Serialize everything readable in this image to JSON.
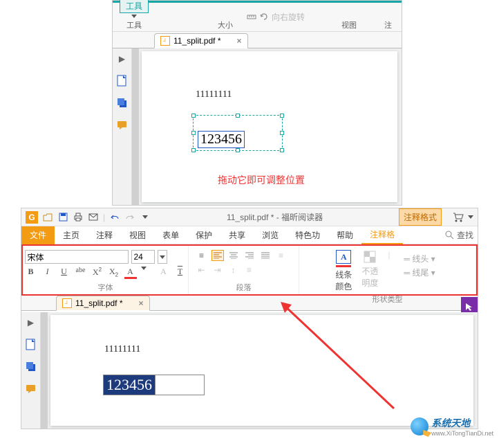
{
  "top": {
    "ribbon": {
      "tool_group": "工具",
      "tool_label": "工具",
      "size_label": "大小",
      "rotate_text": "向右旋转",
      "view_label": "视图",
      "annot_label": "注"
    },
    "tab": {
      "filename": "11_split.pdf *",
      "close": "×"
    },
    "doc": {
      "text1": "11111111",
      "boxtext": "123456"
    },
    "note": "拖动它即可调整位置"
  },
  "bottom": {
    "title_doc": "11_split.pdf *",
    "title_app": "- 福昕阅读器",
    "menu": {
      "file": "文件",
      "home": "主页",
      "comment": "注释",
      "view": "视图",
      "form": "表单",
      "protect": "保护",
      "share": "共享",
      "browse": "浏览",
      "features": "特色功",
      "help": "帮助",
      "annot_format": "注释格式",
      "annot_tab": "注释格"
    },
    "search": {
      "label": "查找"
    },
    "ribbon": {
      "font_name": "宋体",
      "font_size": "24",
      "group_font": "字体",
      "group_para": "段落",
      "group_shape": "形状类型",
      "line_color": "线条\n颜色",
      "opacity": "不透\n明度",
      "line_head": "线头",
      "line_tail": "线尾"
    },
    "tab": {
      "filename": "11_split.pdf *",
      "close": "×"
    },
    "doc": {
      "text1": "11111111",
      "boxtext": "123456"
    }
  },
  "watermark": {
    "title": "系统天地",
    "sub": "www.XiTongTianDi.net"
  }
}
